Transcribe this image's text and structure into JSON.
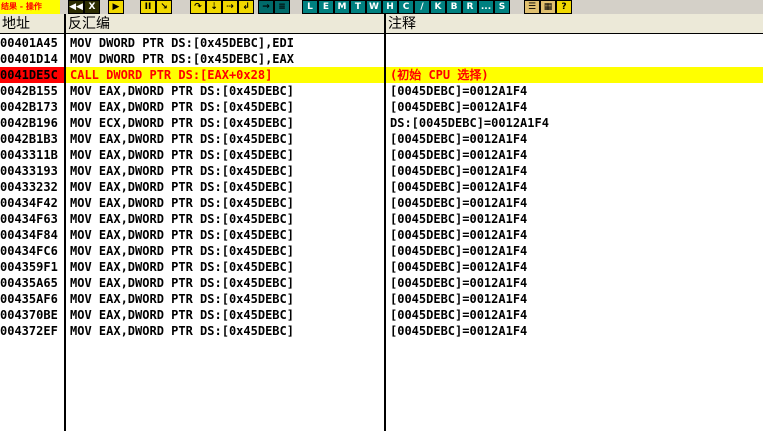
{
  "toolbar": {
    "title_tag": "结果 - 操作",
    "buttons": [
      {
        "name": "rewind-icon",
        "glyph": "◀◀",
        "style": "dark"
      },
      {
        "name": "close-icon",
        "glyph": "X",
        "style": "dark"
      },
      {
        "name": "run-icon",
        "glyph": "▶",
        "style": "yellow"
      },
      {
        "name": "pause-icon",
        "glyph": "II",
        "style": "yellow"
      },
      {
        "name": "step-into-icon",
        "glyph": "↘",
        "style": "yellow"
      },
      {
        "name": "step-over-icon",
        "glyph": "↷",
        "style": "yellow"
      },
      {
        "name": "trace-into-icon",
        "glyph": "⇣",
        "style": "yellow"
      },
      {
        "name": "trace-over-icon",
        "glyph": "⇢",
        "style": "yellow"
      },
      {
        "name": "execute-till-return-icon",
        "glyph": "↲",
        "style": "yellow"
      },
      {
        "name": "go-to-icon",
        "glyph": "→",
        "style": "tealbg"
      },
      {
        "name": "list-icon",
        "glyph": "≡",
        "style": "tealbg"
      },
      {
        "name": "button-l",
        "glyph": "L",
        "style": "letter"
      },
      {
        "name": "button-e",
        "glyph": "E",
        "style": "letter"
      },
      {
        "name": "button-m",
        "glyph": "M",
        "style": "letter"
      },
      {
        "name": "button-t",
        "glyph": "T",
        "style": "letter"
      },
      {
        "name": "button-w",
        "glyph": "W",
        "style": "letter"
      },
      {
        "name": "button-h",
        "glyph": "H",
        "style": "letter"
      },
      {
        "name": "button-c",
        "glyph": "C",
        "style": "letter"
      },
      {
        "name": "button-slash",
        "glyph": "/",
        "style": "letter"
      },
      {
        "name": "button-k",
        "glyph": "K",
        "style": "letter"
      },
      {
        "name": "button-b",
        "glyph": "B",
        "style": "letter"
      },
      {
        "name": "button-r",
        "glyph": "R",
        "style": "letter"
      },
      {
        "name": "button-dots",
        "glyph": "...",
        "style": "letter"
      },
      {
        "name": "button-s",
        "glyph": "S",
        "style": "letter"
      },
      {
        "name": "list-view-icon",
        "glyph": "☰",
        "style": "grid"
      },
      {
        "name": "grid-view-icon",
        "glyph": "▦",
        "style": "grid"
      },
      {
        "name": "help-icon",
        "glyph": "?",
        "style": "help"
      }
    ]
  },
  "columns": {
    "address": "地址",
    "disassembly": "反汇编",
    "comment": "注释"
  },
  "rows": [
    {
      "addr": "00401A45",
      "dis": "MOV DWORD PTR DS:[0x45DEBC],EDI",
      "cmt": "",
      "selected": false
    },
    {
      "addr": "00401D14",
      "dis": "MOV DWORD PTR DS:[0x45DEBC],EAX",
      "cmt": "",
      "selected": false
    },
    {
      "addr": "0041DE5C",
      "dis": "CALL DWORD PTR DS:[EAX+0x28]",
      "cmt": "(初始 CPU 选择)",
      "selected": true
    },
    {
      "addr": "0042B155",
      "dis": "MOV EAX,DWORD PTR DS:[0x45DEBC]",
      "cmt": "[0045DEBC]=0012A1F4",
      "selected": false
    },
    {
      "addr": "0042B173",
      "dis": "MOV EAX,DWORD PTR DS:[0x45DEBC]",
      "cmt": "[0045DEBC]=0012A1F4",
      "selected": false
    },
    {
      "addr": "0042B196",
      "dis": "MOV ECX,DWORD PTR DS:[0x45DEBC]",
      "cmt": "DS:[0045DEBC]=0012A1F4",
      "selected": false
    },
    {
      "addr": "0042B1B3",
      "dis": "MOV EAX,DWORD PTR DS:[0x45DEBC]",
      "cmt": "[0045DEBC]=0012A1F4",
      "selected": false
    },
    {
      "addr": "0043311B",
      "dis": "MOV EAX,DWORD PTR DS:[0x45DEBC]",
      "cmt": "[0045DEBC]=0012A1F4",
      "selected": false
    },
    {
      "addr": "00433193",
      "dis": "MOV EAX,DWORD PTR DS:[0x45DEBC]",
      "cmt": "[0045DEBC]=0012A1F4",
      "selected": false
    },
    {
      "addr": "00433232",
      "dis": "MOV EAX,DWORD PTR DS:[0x45DEBC]",
      "cmt": "[0045DEBC]=0012A1F4",
      "selected": false
    },
    {
      "addr": "00434F42",
      "dis": "MOV EAX,DWORD PTR DS:[0x45DEBC]",
      "cmt": "[0045DEBC]=0012A1F4",
      "selected": false
    },
    {
      "addr": "00434F63",
      "dis": "MOV EAX,DWORD PTR DS:[0x45DEBC]",
      "cmt": "[0045DEBC]=0012A1F4",
      "selected": false
    },
    {
      "addr": "00434F84",
      "dis": "MOV EAX,DWORD PTR DS:[0x45DEBC]",
      "cmt": "[0045DEBC]=0012A1F4",
      "selected": false
    },
    {
      "addr": "00434FC6",
      "dis": "MOV EAX,DWORD PTR DS:[0x45DEBC]",
      "cmt": "[0045DEBC]=0012A1F4",
      "selected": false
    },
    {
      "addr": "004359F1",
      "dis": "MOV EAX,DWORD PTR DS:[0x45DEBC]",
      "cmt": "[0045DEBC]=0012A1F4",
      "selected": false
    },
    {
      "addr": "00435A65",
      "dis": "MOV EAX,DWORD PTR DS:[0x45DEBC]",
      "cmt": "[0045DEBC]=0012A1F4",
      "selected": false
    },
    {
      "addr": "00435AF6",
      "dis": "MOV EAX,DWORD PTR DS:[0x45DEBC]",
      "cmt": "[0045DEBC]=0012A1F4",
      "selected": false
    },
    {
      "addr": "004370BE",
      "dis": "MOV EAX,DWORD PTR DS:[0x45DEBC]",
      "cmt": "[0045DEBC]=0012A1F4",
      "selected": false
    },
    {
      "addr": "004372EF",
      "dis": "MOV EAX,DWORD PTR DS:[0x45DEBC]",
      "cmt": "[0045DEBC]=0012A1F4",
      "selected": false
    }
  ],
  "colors": {
    "selected_row_bg": "#ffff00",
    "selected_row_text": "#ff0000",
    "selected_addr_bg": "#ff0000",
    "toolbar_bg": "#d4d0c8"
  }
}
